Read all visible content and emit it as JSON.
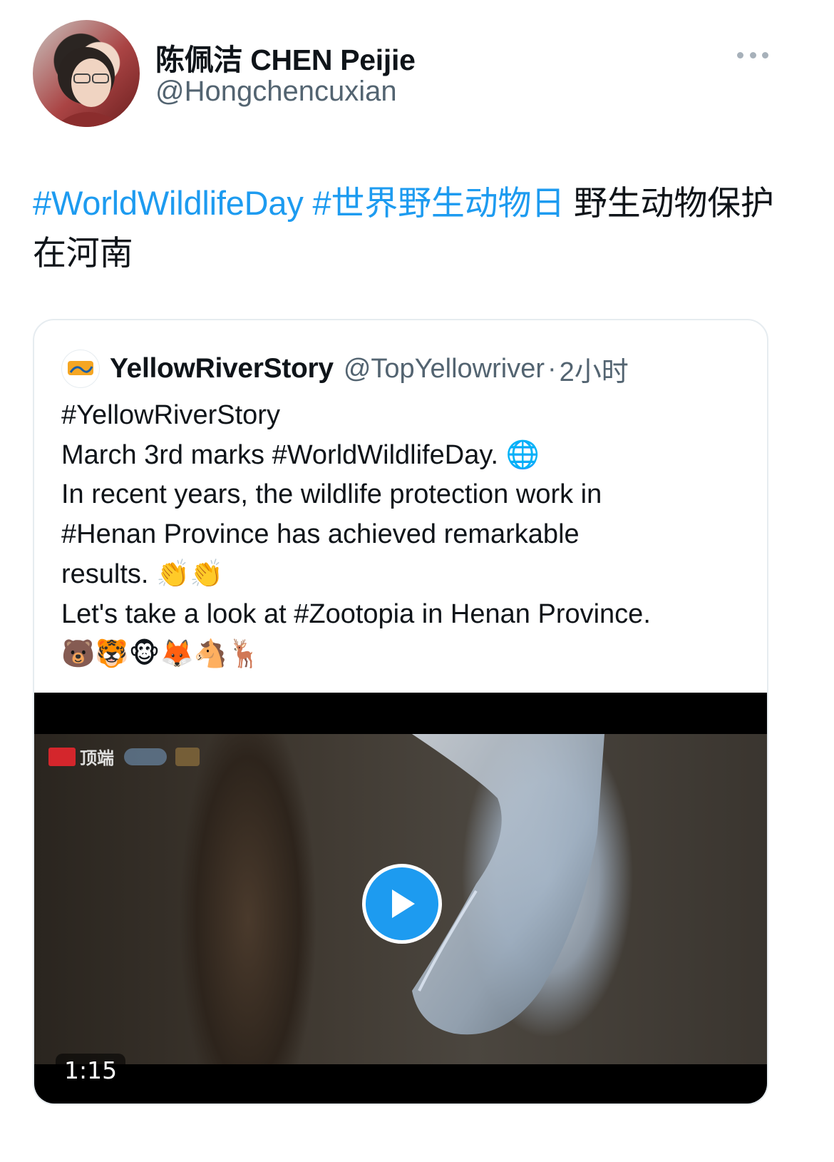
{
  "author": {
    "display_name": "陈佩洁 CHEN Peijie",
    "handle": "@Hongchencuxian"
  },
  "tweet": {
    "hashtag_1": "#WorldWildlifeDay",
    "hashtag_2": "#世界野生动物日",
    "text_rest": " 野生动物保护在河南"
  },
  "quoted_tweet": {
    "display_name": "YellowRiverStory",
    "handle": "@TopYellowriver",
    "separator": "·",
    "time": "2小时",
    "lines": [
      "#YellowRiverStory",
      "March 3rd marks #WorldWildlifeDay. 🌐",
      "In recent years, the wildlife protection work in",
      "#Henan Province has achieved remarkable",
      "results. 👏👏",
      "Let's take a look at #Zootopia in Henan Province.",
      "🐻🐯🐵🦊🐴🦌"
    ],
    "video": {
      "duration": "1:15",
      "logo_text": "顶端"
    }
  },
  "icons": {
    "more": "more-horizontal-icon",
    "play": "play-icon"
  },
  "colors": {
    "link": "#1d9bf0",
    "secondary_text": "#536471",
    "border": "#e6ecf0"
  }
}
